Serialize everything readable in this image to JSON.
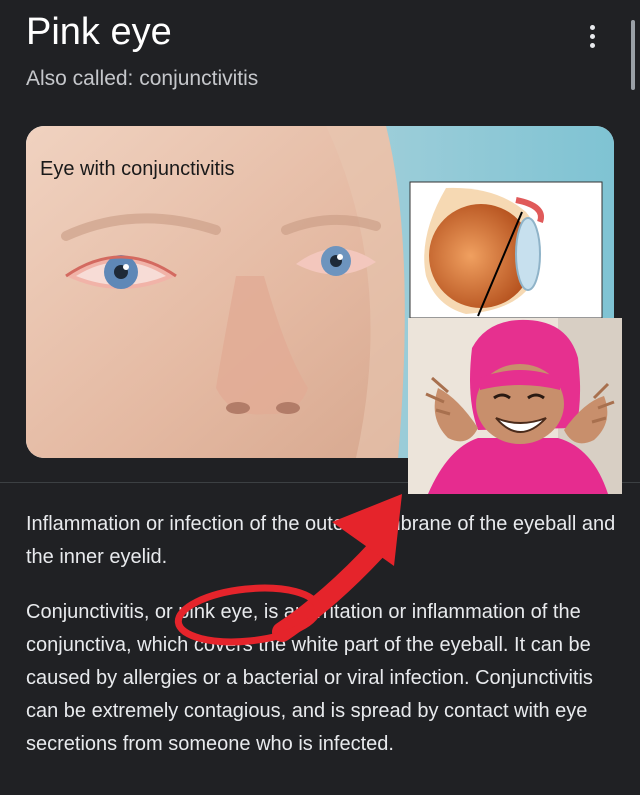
{
  "header": {
    "title": "Pink eye",
    "subtitle": "Also called: conjunctivitis",
    "more_icon": "more-vert-icon"
  },
  "image_card": {
    "label": "Eye with conjunctivitis"
  },
  "description": {
    "paragraph1": "Inflammation or infection of the outer membrane of the eyeball and the inner eyelid.",
    "paragraph2": "Conjunctivitis, or pink eye, is an irritation or inflammation of the conjunctiva, which covers the white part of the eyeball. It can be caused by allergies or a bacterial or viral infection. Conjunctivitis can be extremely contagious, and is spread by contact with eye secretions from someone who is infected."
  },
  "colors": {
    "background": "#202124",
    "annotation_red": "#e5242b",
    "hood_pink": "#e62c8f"
  }
}
